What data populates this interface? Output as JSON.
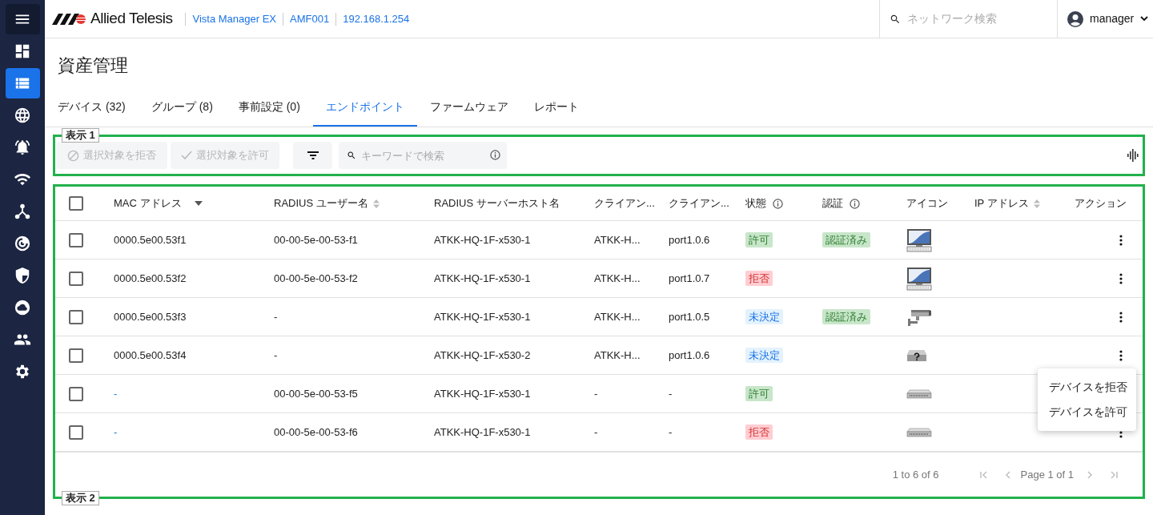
{
  "sidebar": {
    "items": [
      {
        "selected": false
      },
      {
        "selected": false
      },
      {
        "selected": true
      },
      {
        "selected": false
      },
      {
        "selected": false
      },
      {
        "selected": false
      },
      {
        "selected": false
      },
      {
        "selected": false
      },
      {
        "selected": false
      },
      {
        "selected": false
      },
      {
        "selected": false
      },
      {
        "selected": false
      }
    ]
  },
  "header": {
    "logo": "Allied Telesis",
    "breadcrumbs": [
      "Vista Manager EX",
      "AMF001",
      "192.168.1.254"
    ],
    "search": {
      "placeholder": "ネットワーク検索"
    },
    "user": "manager"
  },
  "page_title": "資産管理",
  "tabs": [
    {
      "label": "デバイス",
      "count": "(32)",
      "selected": false
    },
    {
      "label": "グループ",
      "count": "(8)",
      "selected": false
    },
    {
      "label": "事前設定",
      "count": "(0)",
      "selected": false
    },
    {
      "label": "エンドポイント",
      "selected": true
    },
    {
      "label": "ファームウェア",
      "selected": false
    },
    {
      "label": "レポート",
      "selected": false
    }
  ],
  "annotations": [
    "表示 1",
    "表示 2"
  ],
  "toolbar": {
    "deny_button": "選択対象を拒否",
    "allow_button": "選択対象を許可",
    "buttons_disabled": true,
    "search": {
      "placeholder": "キーワードで検索"
    }
  },
  "table": {
    "select_all": {
      "checked": false
    },
    "columns": [
      {
        "label": "MAC アドレス",
        "kind": "sorted_desc"
      },
      {
        "label": "RADIUS ユーザー名",
        "kind": "sortable"
      },
      {
        "label": "RADIUS サーバーホスト名",
        "kind": "plain"
      },
      {
        "label": "クライアン...",
        "kind": "plain"
      },
      {
        "label": "クライアン...",
        "kind": "plain"
      },
      {
        "label": "状態",
        "kind": "info"
      },
      {
        "label": "認証",
        "kind": "info"
      },
      {
        "label": "アイコン",
        "kind": "plain"
      },
      {
        "label": "IP アドレス",
        "kind": "sortable"
      },
      {
        "label": "アクション",
        "kind": "plain"
      }
    ],
    "rows": [
      {
        "checked": false,
        "mac": "0000.5e00.53f1",
        "user": "00-00-5e-00-53-f1",
        "host": "ATKK-HQ-1F-x530-1",
        "client_1": "ATKK-H...",
        "client_2": "port1.0.6",
        "state": {
          "label": "許可",
          "kind": "allow"
        },
        "auth": "認証済み",
        "icon": {
          "kind": "pc"
        }
      },
      {
        "checked": false,
        "mac": "0000.5e00.53f2",
        "user": "00-00-5e-00-53-f2",
        "host": "ATKK-HQ-1F-x530-1",
        "client_1": "ATKK-H...",
        "client_2": "port1.0.7",
        "state": {
          "label": "拒否",
          "kind": "deny"
        },
        "icon": {
          "kind": "pc"
        }
      },
      {
        "checked": false,
        "mac": "0000.5e00.53f3",
        "user": "-",
        "host": "ATKK-HQ-1F-x530-1",
        "client_1": "ATKK-H...",
        "client_2": "port1.0.5",
        "state": {
          "label": "未決定",
          "kind": "pending"
        },
        "auth": "認証済み",
        "icon": {
          "kind": "camera"
        }
      },
      {
        "checked": false,
        "mac": "0000.5e00.53f4",
        "user": "-",
        "host": "ATKK-HQ-1F-x530-2",
        "client_1": "ATKK-H...",
        "client_2": "port1.0.6",
        "state": {
          "label": "未決定",
          "kind": "pending"
        },
        "icon": {
          "kind": "unknown"
        }
      },
      {
        "checked": false,
        "mac": "-",
        "user": "00-00-5e-00-53-f5",
        "host": "ATKK-HQ-1F-x530-1",
        "client_1": "-",
        "client_2": "-",
        "state": {
          "label": "許可",
          "kind": "allow"
        },
        "icon": {
          "kind": "switch"
        }
      },
      {
        "checked": false,
        "mac": "-",
        "user": "00-00-5e-00-53-f6",
        "host": "ATKK-HQ-1F-x530-1",
        "client_1": "-",
        "client_2": "-",
        "state": {
          "label": "拒否",
          "kind": "deny"
        },
        "icon": {
          "kind": "switch"
        }
      }
    ]
  },
  "context_menu": {
    "items": [
      "デバイスを拒否",
      "デバイスを許可"
    ]
  },
  "pagination": {
    "range": "1 to 6 of 6",
    "page": "Page 1 of 1"
  }
}
